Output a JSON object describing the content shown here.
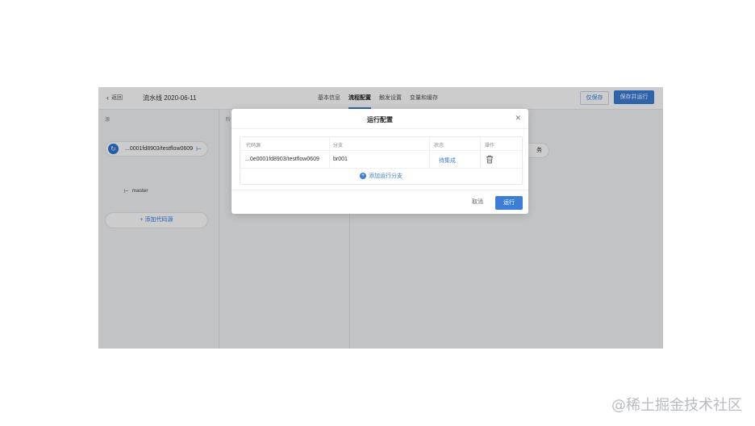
{
  "topbar": {
    "back_label": "返回",
    "pipeline_title": "流水线 2020-06-11",
    "tabs": [
      {
        "label": "基本信息"
      },
      {
        "label": "流程配置"
      },
      {
        "label": "触发设置"
      },
      {
        "label": "变量和缓存"
      }
    ],
    "save_label": "仅保存",
    "save_run_label": "保存并运行"
  },
  "sidebar": {
    "column_label": "源",
    "repo_name": "...0001fd8903/testflow0609",
    "branch": "master",
    "add_source_label": "+ 添加代码源"
  },
  "stage": {
    "column_label": "阶",
    "task_label": "务"
  },
  "modal": {
    "title": "运行配置",
    "columns": [
      "代码源",
      "分支",
      "状态",
      "操作"
    ],
    "rows": [
      {
        "source": "...0e0001fd8903/testflow0609",
        "branch": "br001",
        "status": "待集成"
      }
    ],
    "add_branch_label": "添加运行分支",
    "cancel_label": "取消",
    "run_label": "运行"
  },
  "watermark": "@稀土掘金技术社区",
  "colors": {
    "accent": "#3a7ed8",
    "overlay": "rgba(0,0,0,0.2)"
  }
}
